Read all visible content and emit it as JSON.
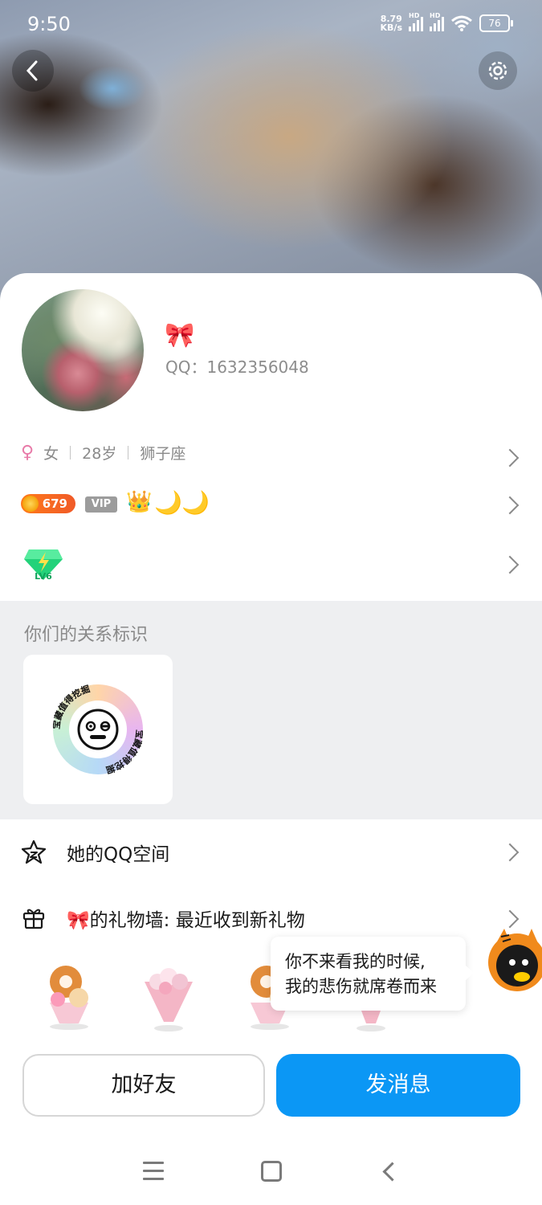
{
  "status_bar": {
    "time": "9:50",
    "net_speed_value": "8.79",
    "net_speed_unit": "KB/s",
    "hd1": "HD",
    "hd2": "HD",
    "battery": "76"
  },
  "header": {
    "back_icon": "back-arrow-icon",
    "settings_icon": "gear-icon"
  },
  "profile": {
    "nickname": "🎀",
    "qq_label": "QQ：1632356048",
    "gender": "女",
    "age": "28岁",
    "zodiac": "狮子座"
  },
  "badges": {
    "coin_count": "679",
    "vip_label": "VIP",
    "crown": "👑",
    "moon1": "🌙",
    "moon2": "🌙",
    "gem_label": "LV6"
  },
  "relationship": {
    "title": "你们的关系标识",
    "badge_text": "宝藏值得挖掘"
  },
  "menu": {
    "qzone_label": "她的QQ空间",
    "gift_wall_label": "🎀的礼物墙: 最近收到新礼物"
  },
  "bubble": {
    "line1": "你不来看我的时候,",
    "line2": "我的悲伤就席卷而来"
  },
  "buttons": {
    "add_friend": "加好友",
    "send_message": "发消息"
  },
  "colors": {
    "accent_blue": "#0b97f5",
    "section_bg": "#eeeff1",
    "coin_orange": "#f05a28"
  }
}
